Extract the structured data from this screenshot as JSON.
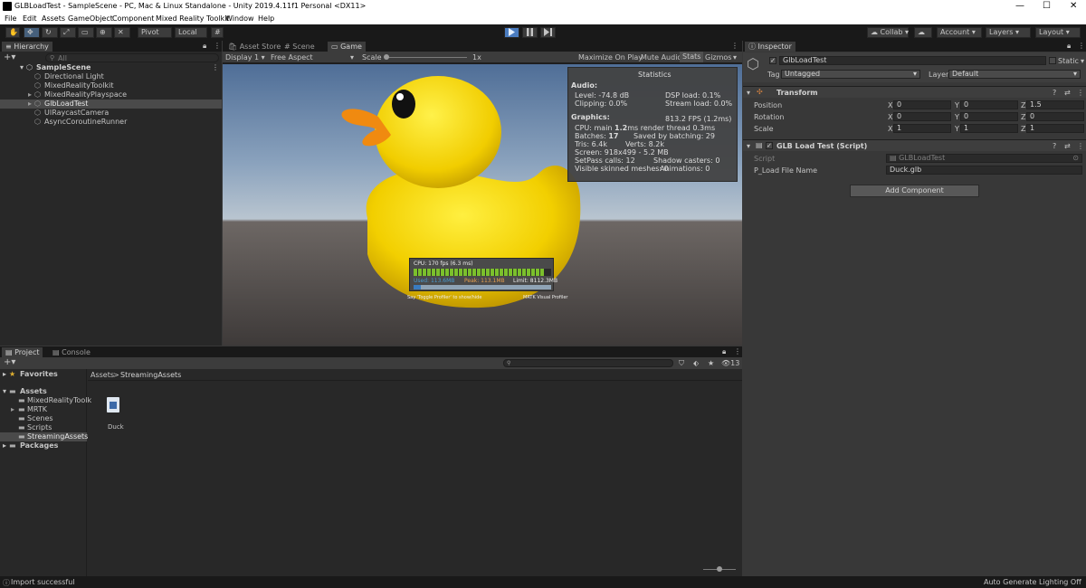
{
  "window": {
    "title": "GLBLoadTest - SampleScene - PC, Mac & Linux Standalone - Unity 2019.4.11f1 Personal <DX11>",
    "minimize": "—",
    "maximize": "☐",
    "close": "✕"
  },
  "menu": [
    "File",
    "Edit",
    "Assets",
    "GameObject",
    "Component",
    "Mixed Reality Toolkit",
    "Window",
    "Help"
  ],
  "toolbar": {
    "pivot": "Pivot",
    "local": "Local",
    "collab": "Collab",
    "account": "Account",
    "layers": "Layers",
    "layout": "Layout"
  },
  "hierarchy": {
    "tab": "Hierarchy",
    "search_placeholder": "All",
    "scene": "SampleScene",
    "items": [
      "Directional Light",
      "MixedRealityToolkit",
      "MixedRealityPlayspace",
      "GlbLoadTest",
      "UIRaycastCamera",
      "AsyncCoroutineRunner"
    ],
    "selected": "GlbLoadTest"
  },
  "center_tabs": [
    "Asset Store",
    "Scene",
    "Game"
  ],
  "active_center_tab": "Game",
  "game_bar": {
    "display": "Display 1",
    "aspect": "Free Aspect",
    "scale_label": "Scale",
    "scale_value": "1x",
    "maximize": "Maximize On Play",
    "mute": "Mute Audio",
    "stats": "Stats",
    "gizmos": "Gizmos"
  },
  "stats": {
    "title": "Statistics",
    "audio_header": "Audio:",
    "level": "Level: -74.8 dB",
    "dsp": "DSP load: 0.1%",
    "clipping": "Clipping: 0.0%",
    "stream": "Stream load: 0.0%",
    "graphics_header": "Graphics:",
    "fps": "813.2 FPS (1.2ms)",
    "cpu_prefix": "CPU: main ",
    "cpu_main": "1.2",
    "cpu_suffix": "ms  render thread 0.3ms",
    "batches_prefix": "Batches: ",
    "batches": "17",
    "saved": "Saved by batching: 29",
    "tris": "Tris: 6.4k",
    "verts": "Verts: 8.2k",
    "screen": "Screen: 918x499 - 5.2 MB",
    "setpass": "SetPass calls: 12",
    "shadow": "Shadow casters: 0",
    "skinned": "Visible skinned meshes: 0",
    "animations": "Animations: 0"
  },
  "profiler_overlay": {
    "cpu": "CPU: 170 fps (6.3 ms)",
    "used": "Used: 113.6MB",
    "peak": "Peak: 113.1MB",
    "limit": "Limit: 8112.3MB",
    "cpu_fill_fraction": 0.95,
    "mem_fill_fraction": 0.05,
    "left_caption": "Say 'Toggle Profiler' to show/hide",
    "right_caption": "MRTK Visual Profiler"
  },
  "inspector": {
    "tab": "Inspector",
    "object_name": "GlbLoadTest",
    "static_label": "Static",
    "tag_label": "Tag",
    "tag_value": "Untagged",
    "layer_label": "Layer",
    "layer_value": "Default",
    "transform": {
      "title": "Transform",
      "position_label": "Position",
      "rotation_label": "Rotation",
      "scale_label": "Scale",
      "position": [
        "0",
        "0",
        "1.5"
      ],
      "rotation": [
        "0",
        "0",
        "0"
      ],
      "scale": [
        "1",
        "1",
        "1"
      ],
      "axes": [
        "X",
        "Y",
        "Z"
      ]
    },
    "script_component": {
      "title": "GLB Load Test (Script)",
      "script_label": "Script",
      "script_value": "GLBLoadTest",
      "file_label": "P_Load File Name",
      "file_value": "Duck.glb"
    },
    "add_component": "Add Component"
  },
  "project": {
    "tabs": [
      "Project",
      "Console"
    ],
    "hidden_count": "13",
    "favorites": "Favorites",
    "assets": "Assets",
    "folders": [
      "MixedRealityToolk",
      "MRTK",
      "Scenes",
      "Scripts",
      "StreamingAssets"
    ],
    "packages": "Packages",
    "breadcrumb": [
      "Assets",
      "StreamingAssets"
    ],
    "breadcrumb_sep": ">",
    "file_name": "Duck"
  },
  "status": {
    "left": "Import successful",
    "right": "Auto Generate Lighting Off"
  },
  "colors": {
    "selection": "#2c5d87",
    "play_blue": "#5a8ecf",
    "duck_yellow": "#f5d000",
    "beak_orange": "#f08a10"
  }
}
